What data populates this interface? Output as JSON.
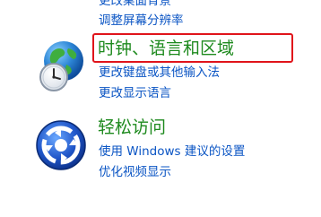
{
  "appearance_section": {
    "links": [
      "更改桌面背景",
      "调整屏幕分辨率"
    ]
  },
  "clock_section": {
    "title": "时钟、语言和区域",
    "links": [
      "更改键盘或其他输入法",
      "更改显示语言"
    ],
    "icon": "globe-clock-icon"
  },
  "ease_section": {
    "title": "轻松访问",
    "links": [
      "使用 Windows 建议的设置",
      "优化视频显示"
    ],
    "icon": "ease-of-access-icon"
  },
  "colors": {
    "link": "#0b55c4",
    "category_title": "#1e8a1e",
    "highlight": "#e0141b"
  }
}
